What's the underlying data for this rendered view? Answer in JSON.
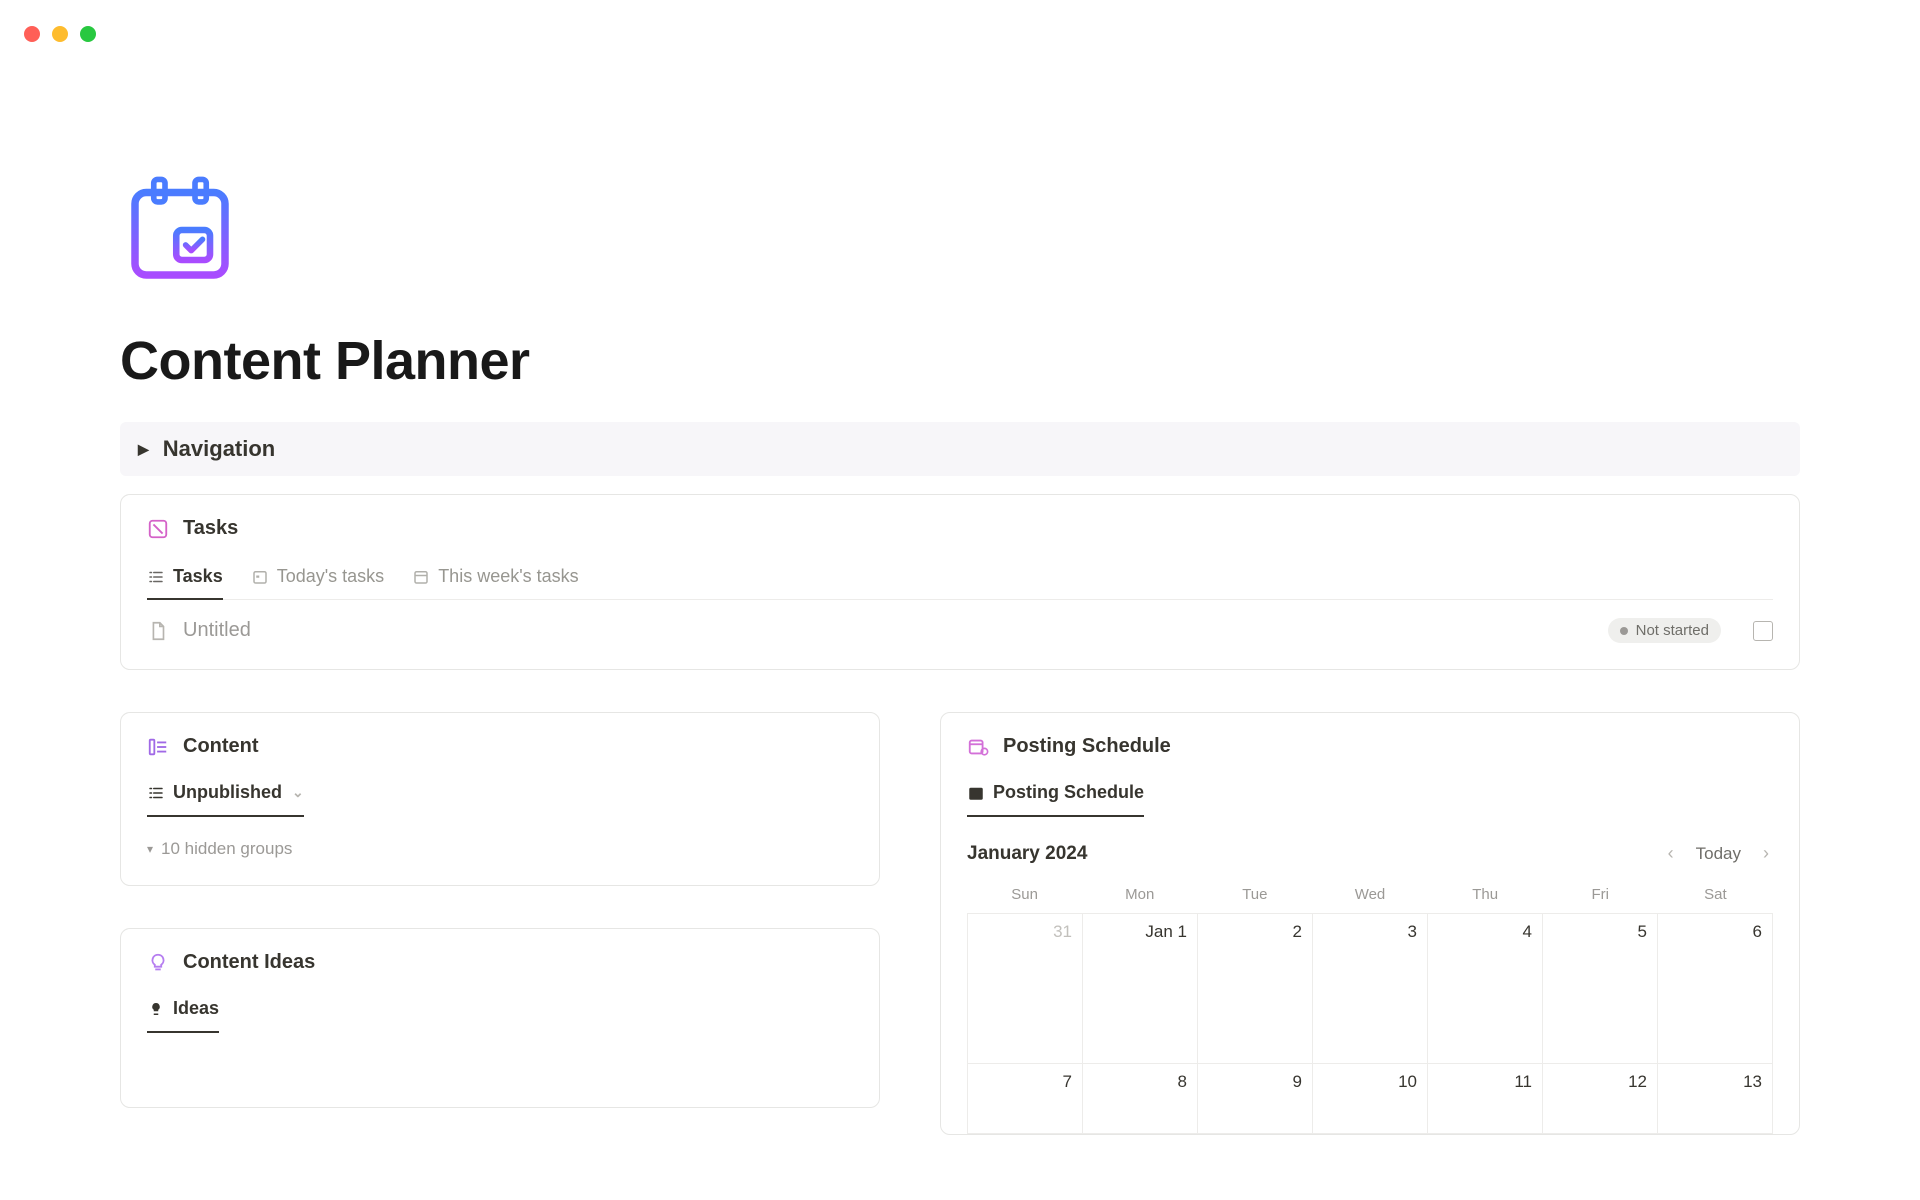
{
  "title": "Content Planner",
  "navigation": {
    "label": "Navigation"
  },
  "tasks": {
    "title": "Tasks",
    "tabs": [
      {
        "label": "Tasks"
      },
      {
        "label": "Today's tasks"
      },
      {
        "label": "This week's tasks"
      }
    ],
    "row": {
      "name": "Untitled",
      "status": "Not started"
    }
  },
  "content": {
    "title": "Content",
    "view": "Unpublished",
    "hidden_groups_label": "10 hidden groups"
  },
  "ideas": {
    "title": "Content Ideas",
    "view": "Ideas"
  },
  "schedule": {
    "title": "Posting Schedule",
    "view": "Posting Schedule",
    "month": "January 2024",
    "today_label": "Today",
    "dow": [
      "Sun",
      "Mon",
      "Tue",
      "Wed",
      "Thu",
      "Fri",
      "Sat"
    ],
    "cells": {
      "r0": [
        "31",
        "Jan 1",
        "2",
        "3",
        "4",
        "5",
        "6"
      ],
      "r1": [
        "7",
        "8",
        "9",
        "10",
        "11",
        "12",
        "13"
      ]
    }
  }
}
